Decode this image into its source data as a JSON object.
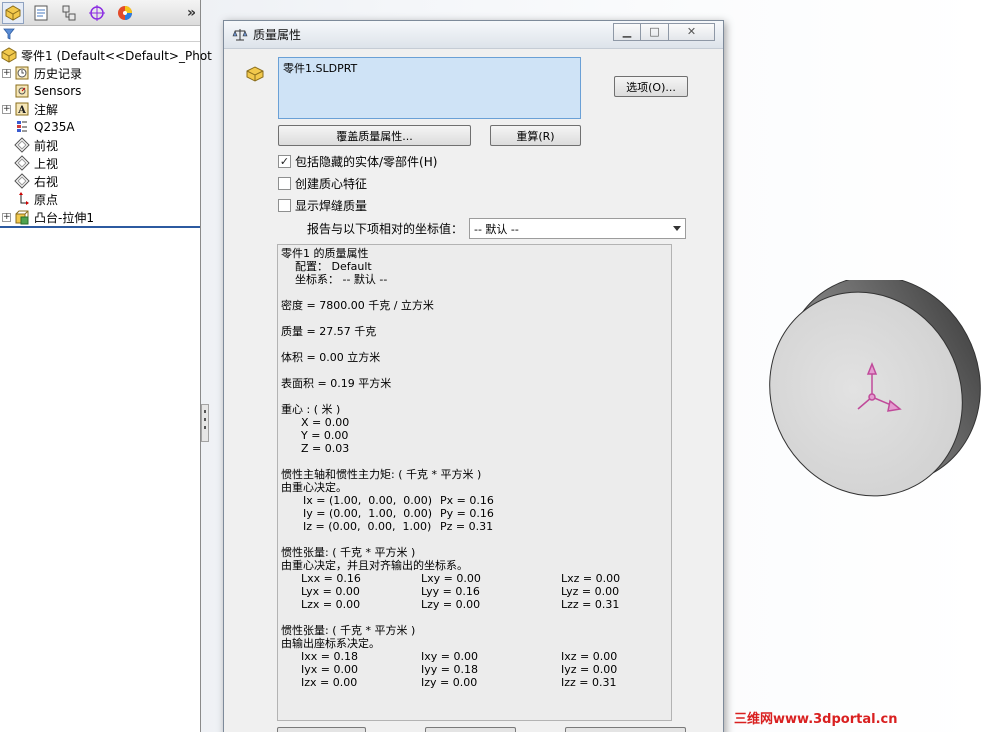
{
  "feature_manager": {
    "root_label": "零件1  (Default<<Default>_Phot",
    "items": [
      {
        "label": "历史记录",
        "icon": "history-icon",
        "expandable": true
      },
      {
        "label": "Sensors",
        "icon": "sensor-icon",
        "expandable": false
      },
      {
        "label": "注解",
        "icon": "annotation-icon",
        "expandable": true
      },
      {
        "label": "Q235A",
        "icon": "material-icon",
        "expandable": false
      },
      {
        "label": "前视",
        "icon": "plane-icon",
        "expandable": false
      },
      {
        "label": "上视",
        "icon": "plane-icon",
        "expandable": false
      },
      {
        "label": "右视",
        "icon": "plane-icon",
        "expandable": false
      },
      {
        "label": "原点",
        "icon": "origin-icon",
        "expandable": false
      },
      {
        "label": "凸台-拉伸1",
        "icon": "extrude-icon",
        "expandable": true
      }
    ],
    "expand_glyph": "»"
  },
  "dialog": {
    "title": "质量属性",
    "selection": "零件1.SLDPRT",
    "options_button": "选项(O)...",
    "override_button": "覆盖质量属性...",
    "recalc_button": "重算(R)",
    "checkboxes": [
      {
        "label": "包括隐藏的实体/零部件(H)",
        "checked": true
      },
      {
        "label": "创建质心特征",
        "checked": false
      },
      {
        "label": "显示焊缝质量",
        "checked": false
      }
    ],
    "coord_label": "报告与以下项相对的坐标值：",
    "coord_value": "-- 默认 --",
    "report": {
      "header": "零件1 的质量属性",
      "config": "配置： Default",
      "coord_sys": "坐标系： -- 默认 --",
      "density": "密度 = 7800.00 千克 / 立方米",
      "mass": "质量 = 27.57 千克",
      "volume": "体积 = 0.00 立方米",
      "surface_area": "表面积 = 0.19 平方米",
      "cog_title": "重心 : ( 米 )",
      "cog": [
        "X = 0.00",
        "Y = 0.00",
        "Z = 0.03"
      ],
      "principal_title": "惯性主轴和惯性主力矩: ( 千克 * 平方米 )",
      "principal_sub": "由重心决定。",
      "principal_rows": [
        {
          "axis": "Ix = (1.00,  0.00,  0.00)",
          "moment": "Px = 0.16"
        },
        {
          "axis": "Iy = (0.00,  1.00,  0.00)",
          "moment": "Py = 0.16"
        },
        {
          "axis": "Iz = (0.00,  0.00,  1.00)",
          "moment": "Pz = 0.31"
        }
      ],
      "tensor1_title": "惯性张量: ( 千克 * 平方米 )",
      "tensor1_sub": "由重心决定，并且对齐输出的坐标系。",
      "tensor1_rows": [
        [
          "Lxx = 0.16",
          "Lxy = 0.00",
          "Lxz = 0.00"
        ],
        [
          "Lyx = 0.00",
          "Lyy = 0.16",
          "Lyz = 0.00"
        ],
        [
          "Lzx = 0.00",
          "Lzy = 0.00",
          "Lzz = 0.31"
        ]
      ],
      "tensor2_title": "惯性张量: ( 千克 * 平方米 )",
      "tensor2_sub": "由输出座标系决定。",
      "tensor2_rows": [
        [
          "Ixx = 0.18",
          "Ixy = 0.00",
          "Ixz = 0.00"
        ],
        [
          "Iyx = 0.00",
          "Iyy = 0.18",
          "Iyz = 0.00"
        ],
        [
          "Izx = 0.00",
          "Izy = 0.00",
          "Izz = 0.31"
        ]
      ]
    }
  },
  "watermark": "三维网www.3dportal.cn",
  "colors": {
    "selection_bg": "#cfe3f6",
    "tree_separator": "#2c5aa0",
    "model_face": "#d8d8d8",
    "triad": "#c04a9a",
    "watermark": "#d92020"
  }
}
